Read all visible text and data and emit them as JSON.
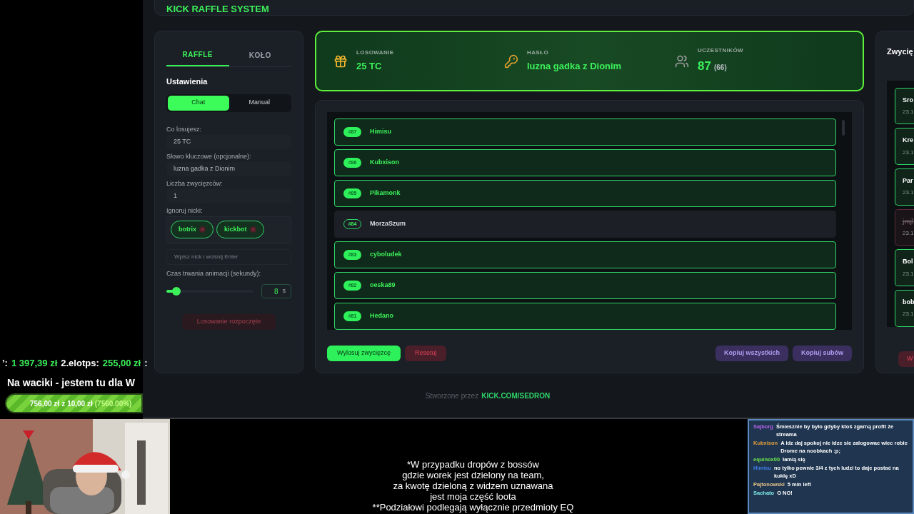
{
  "overlay": {
    "ticker": [
      {
        "kind": "label",
        "text": "’:"
      },
      {
        "kind": "value",
        "text": "1 397,39 zł"
      },
      {
        "kind": "label",
        "text": "2.elotps:"
      },
      {
        "kind": "value",
        "text": "255,00 zł"
      },
      {
        "kind": "label",
        "text": ":"
      }
    ],
    "goal_title": "Na waciki - jestem tu dla W",
    "goal": {
      "current": "756,00 zł",
      "of": "z",
      "target": "10,00 zł",
      "percent": "(7560.00%)",
      "level": 1
    }
  },
  "app": {
    "title": "KICK RAFFLE SYSTEM",
    "tabs": [
      {
        "label": "RAFFLE",
        "selected": true
      },
      {
        "label": "KOŁO",
        "selected": false
      }
    ],
    "settings_title": "Ustawienia",
    "modes": [
      {
        "label": "Chat",
        "selected": true
      },
      {
        "label": "Manual",
        "selected": false
      }
    ],
    "fields": [
      {
        "label": "Co losujesz:",
        "value": "25 TC"
      },
      {
        "label": "Słowo kluczowe (opcjonalne):",
        "value": "luzna gadka z Dionim"
      },
      {
        "label": "Liczba zwycięzców:",
        "value": "1"
      }
    ],
    "ignore_label": "Ignoruj nicki:",
    "ignored": [
      "botrix",
      "kickbot"
    ],
    "ignore_placeholder": "Wpisz nick i wciśnij Enter",
    "duration_label": "Czas trwania animacji (sekundy):",
    "duration": {
      "level": 0.08,
      "value": "8",
      "unit": "s"
    },
    "start_button": {
      "label": "Losowanie rozpoczęte",
      "disabled": true
    },
    "stats": [
      {
        "kind": "gift",
        "label": "LOSOWANIE",
        "value": "25 TC"
      },
      {
        "kind": "key",
        "label": "HASŁO",
        "value": "luzna gadka z Dionim"
      },
      {
        "kind": "people",
        "label": "UCZESTNIKÓW",
        "value": "87",
        "extra": "(66)"
      }
    ],
    "participants": [
      {
        "number": "#87",
        "name": "Himisu",
        "highlighted": true
      },
      {
        "number": "#86",
        "name": "Kubxison",
        "highlighted": true
      },
      {
        "number": "#85",
        "name": "Pikamonk",
        "highlighted": true
      },
      {
        "number": "#84",
        "name": "MorzaSzum",
        "highlighted": false
      },
      {
        "number": "#83",
        "name": "cyboludek",
        "highlighted": true
      },
      {
        "number": "#82",
        "name": "oeska89",
        "highlighted": true
      },
      {
        "number": "#81",
        "name": "Hedano",
        "highlighted": true
      }
    ],
    "actions_left": [
      {
        "kind": "primary",
        "label": "Wylosuj zwycięzcę"
      },
      {
        "kind": "danger",
        "label": "Resetuj"
      }
    ],
    "actions_right": [
      {
        "kind": "purple",
        "label": "Kopiuj wszystkich"
      },
      {
        "kind": "purple",
        "label": "Kopiuj subów"
      }
    ],
    "winners_title": "Zwycię",
    "winners": [
      {
        "name": "Sro",
        "date": "23.1",
        "rejected": false
      },
      {
        "name": "Kre",
        "date": "23.1",
        "rejected": false
      },
      {
        "name": "Par",
        "date": "23.1",
        "rejected": false
      },
      {
        "name": "jmjl",
        "date": "23.1",
        "rejected": true
      },
      {
        "name": "Bol",
        "date": "23.1",
        "rejected": false
      },
      {
        "name": "bob",
        "date": "23.1",
        "rejected": false
      }
    ],
    "winners_button": "W",
    "footer": {
      "text": "Stworzone przez",
      "link": "KICK.COM/SEDRON"
    }
  },
  "subtitle": [
    "*W przypadku dropów z bossów",
    "gdzie worek jest dzielony na team,",
    "za kwotę dzieloną z widzem uznawana",
    "jest moja część loota",
    "**Podziałowi podlegają wyłącznie przedmioty EQ"
  ],
  "chat": [
    {
      "user": "Sajborg",
      "color": "#b463e8",
      "text": "Śmiesznie by było gdyby ktoś zgarną profit że streama"
    },
    {
      "user": "Kubxison",
      "color": "#e8a23a",
      "text": "A idz daj spokoj nie idze sie zalogowac wiec robie Drome na noobkach :p;"
    },
    {
      "user": "equinox00",
      "color": "#6ee84a",
      "text": "łamią się"
    },
    {
      "user": "Himisu",
      "color": "#3d7ee8",
      "text": "no tylko pewnie 3/4 z tych ludzi to daje postać na kuklę xD"
    },
    {
      "user": "Pajtonowski",
      "color": "#e8c48a",
      "text": "5 min left"
    },
    {
      "user": "Sachato",
      "color": "#7ee8e0",
      "text": "O NO!"
    }
  ]
}
